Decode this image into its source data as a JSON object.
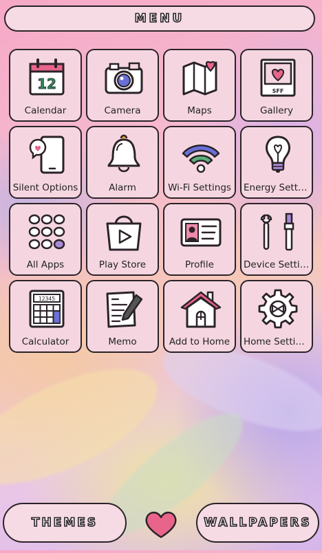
{
  "header": {
    "title": "MENU"
  },
  "apps": [
    {
      "label": "Calendar",
      "icon": "calendar-icon",
      "date": "12"
    },
    {
      "label": "Camera",
      "icon": "camera-icon"
    },
    {
      "label": "Maps",
      "icon": "map-icon"
    },
    {
      "label": "Gallery",
      "icon": "gallery-icon",
      "badge": "SFF"
    },
    {
      "label": "Silent Options",
      "icon": "phone-heart-icon"
    },
    {
      "label": "Alarm",
      "icon": "bell-icon"
    },
    {
      "label": "Wi-Fi Settings",
      "icon": "wifi-icon"
    },
    {
      "label": "Energy Settings",
      "icon": "lightbulb-icon"
    },
    {
      "label": "All Apps",
      "icon": "app-grid-icon"
    },
    {
      "label": "Play Store",
      "icon": "shopping-bag-icon"
    },
    {
      "label": "Profile",
      "icon": "id-card-icon"
    },
    {
      "label": "Device Settings",
      "icon": "tools-icon"
    },
    {
      "label": "Calculator",
      "icon": "calculator-icon",
      "display": "12345"
    },
    {
      "label": "Memo",
      "icon": "memo-pencil-icon"
    },
    {
      "label": "Add to Home",
      "icon": "house-icon"
    },
    {
      "label": "Home Settings",
      "icon": "gear-icon"
    }
  ],
  "footer": {
    "themes_label": "THEMES",
    "wallpapers_label": "WALLPAPERS"
  },
  "colors": {
    "tile_bg": "#f5d6e0",
    "outline": "#2a2228",
    "accent_pink": "#e8648a",
    "accent_green": "#2f8a5a",
    "accent_blue": "#6a70d8",
    "accent_purple": "#a98ad8"
  }
}
